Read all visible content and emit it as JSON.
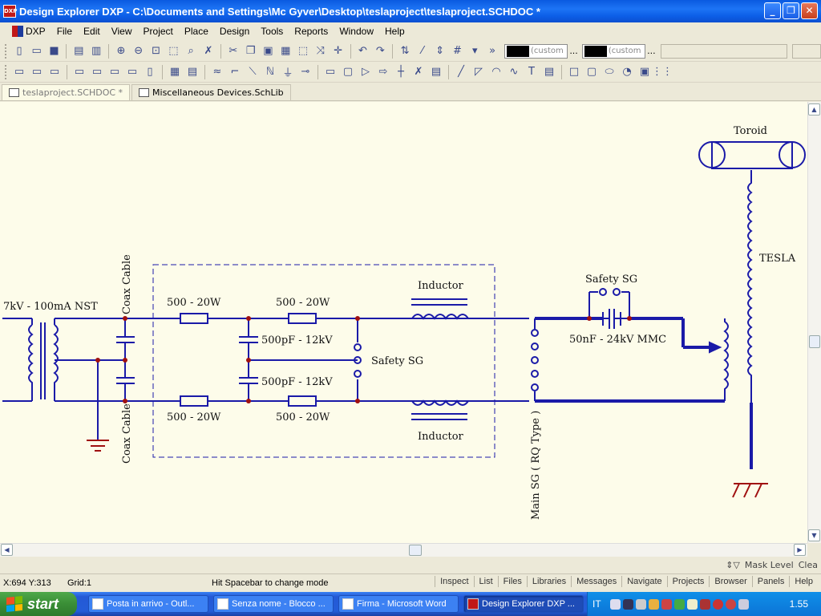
{
  "window": {
    "title": "Design Explorer DXP - C:\\Documents and Settings\\Mc Gyver\\Desktop\\teslaproject\\teslaproject.SCHDOC *",
    "app_icon_text": "DXP"
  },
  "menu": [
    "DXP",
    "File",
    "Edit",
    "View",
    "Project",
    "Place",
    "Design",
    "Tools",
    "Reports",
    "Window",
    "Help"
  ],
  "toolbar": {
    "fill_color_label": "(custom",
    "line_color_label": "(custom",
    "more": "..."
  },
  "tabs": [
    {
      "label": "teslaproject.SCHDOC *",
      "active": true
    },
    {
      "label": "Miscellaneous Devices.SchLib",
      "active": false
    }
  ],
  "schematic": {
    "labels": {
      "nst": "7kV - 100mA  NST",
      "coax_top": "Coax Cable",
      "coax_bottom": "Coax Cable",
      "res1": "500 - 20W",
      "res2": "500 - 20W",
      "res3": "500 - 20W",
      "res4": "500 - 20W",
      "cap_top": "500pF - 12kV",
      "cap_bottom": "500pF - 12kV",
      "safety_sg_left": "Safety SG",
      "inductor_top": "Inductor",
      "inductor_bottom": "Inductor",
      "safety_sg_right": "Safety SG",
      "mmc": "50nF - 24kV MMC",
      "main_sg": "Main SG ( RQ Type )",
      "toroid": "Toroid",
      "tesla": "TESLA"
    },
    "wire_color": "#1a1aa8",
    "junction_color": "#a01010"
  },
  "panelbar": {
    "mask_level": "Mask Level",
    "clear": "Clea"
  },
  "status": {
    "coords": "X:694 Y:313",
    "grid": "Grid:1",
    "hint": "Hit Spacebar to change mode",
    "buttons": [
      "Inspect",
      "List",
      "Files",
      "Libraries",
      "Messages",
      "Navigate",
      "Projects",
      "Browser",
      "Panels",
      "Help"
    ]
  },
  "taskbar": {
    "start": "start",
    "tasks": [
      {
        "label": "Posta in arrivo - Outl...",
        "active": false
      },
      {
        "label": "Senza nome - Blocco ...",
        "active": false
      },
      {
        "label": "Firma - Microsoft Word",
        "active": false
      },
      {
        "label": "Design Explorer DXP ...",
        "active": true
      }
    ],
    "lang": "IT",
    "clock": "1.55"
  }
}
